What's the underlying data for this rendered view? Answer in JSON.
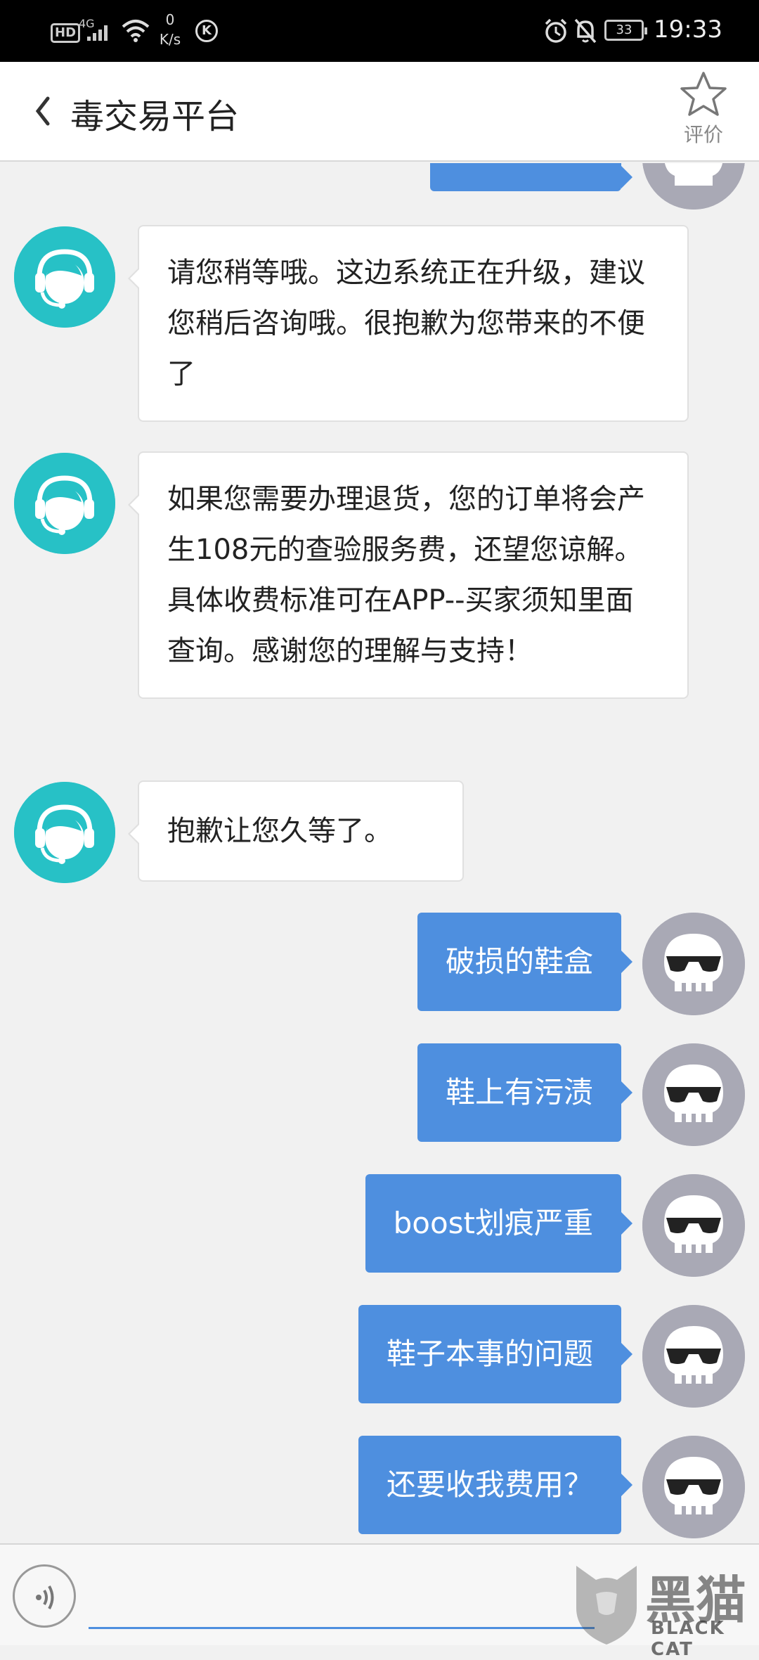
{
  "status_bar": {
    "hd": "HD",
    "network": "4G",
    "speed_value": "0",
    "speed_unit": "K/s",
    "k_badge": "K",
    "battery": "33",
    "time": "19:33"
  },
  "header": {
    "title": "毒交易平台",
    "rate_label": "评价"
  },
  "messages": [
    {
      "sender": "agent",
      "text": "请您稍等哦。这边系统正在升级，建议您稍后咨询哦。很抱歉为您带来的不便了"
    },
    {
      "sender": "agent",
      "text": "如果您需要办理退货，您的订单将会产生108元的查验服务费，还望您谅解。具体收费标准可在APP--买家须知里面查询。感谢您的理解与支持！"
    },
    {
      "sender": "agent",
      "text": "抱歉让您久等了。"
    },
    {
      "sender": "user",
      "text": "破损的鞋盒"
    },
    {
      "sender": "user",
      "text": "鞋上有污渍"
    },
    {
      "sender": "user",
      "text": "boost划痕严重"
    },
    {
      "sender": "user",
      "text": "鞋子本事的问题"
    },
    {
      "sender": "user",
      "text": "还要收我费用？"
    }
  ],
  "input": {
    "placeholder": ""
  },
  "watermark": {
    "cn": "黑猫",
    "en": "BLACK CAT"
  },
  "colors": {
    "agent_avatar": "#27c1c6",
    "user_bubble": "#4e8fdf",
    "user_avatar": "#a9a9b5"
  }
}
